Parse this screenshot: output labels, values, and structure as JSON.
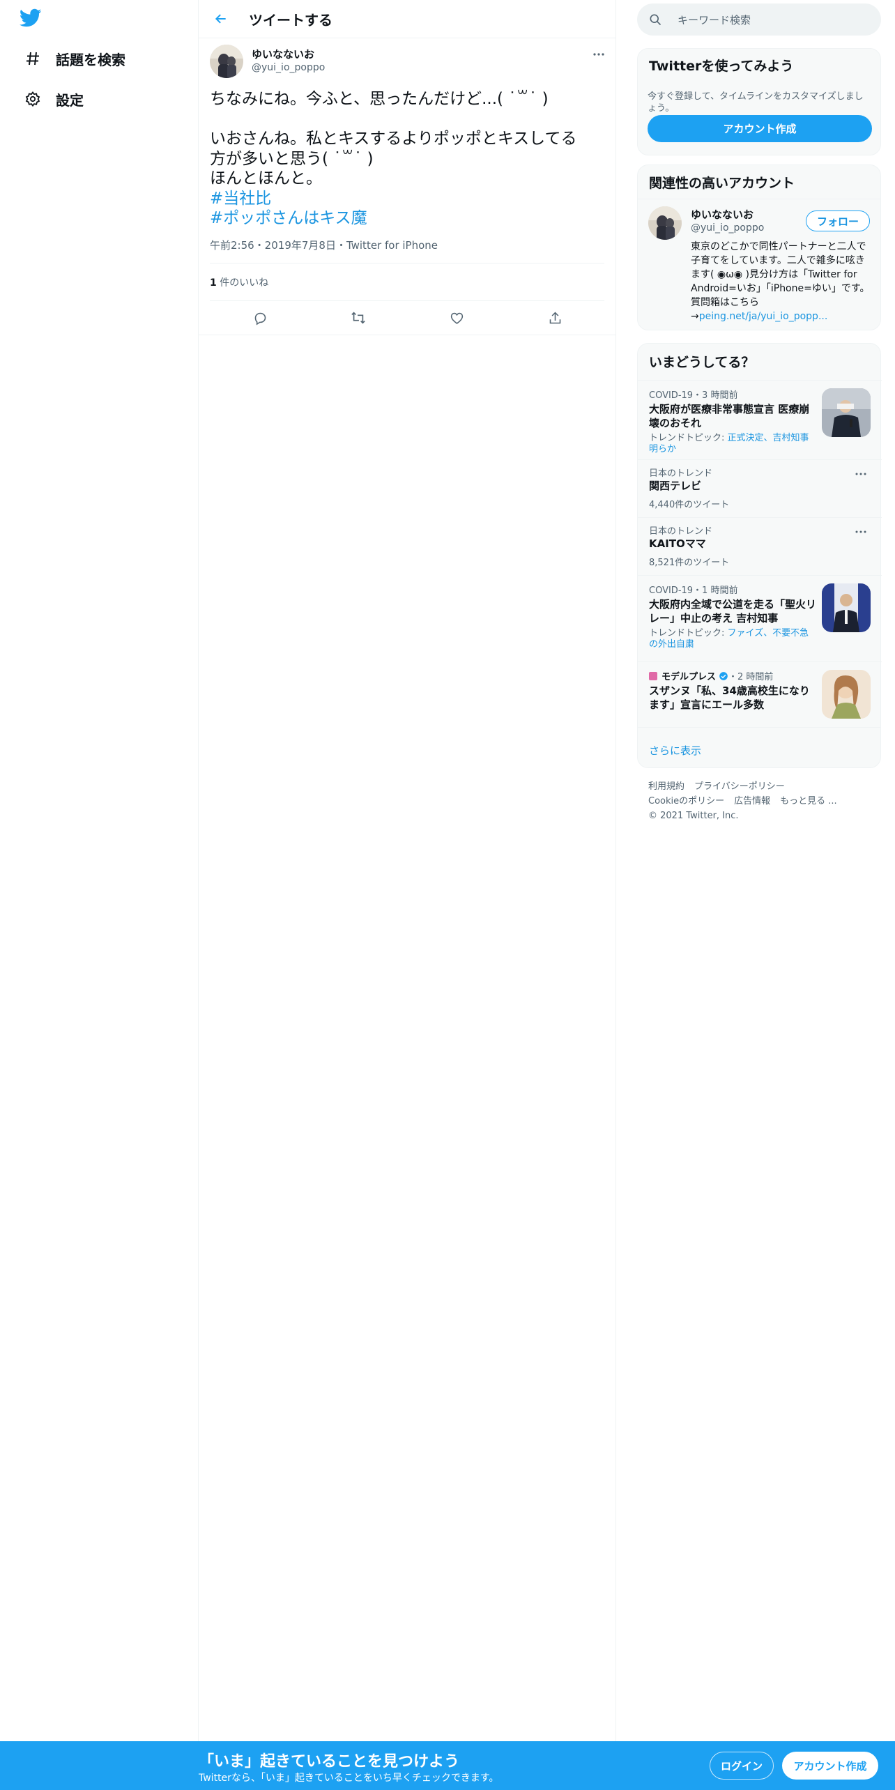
{
  "nav": {
    "items": [
      {
        "label": "話題を検索",
        "icon": "hashtag-icon"
      },
      {
        "label": "設定",
        "icon": "gear-icon"
      }
    ]
  },
  "header": {
    "title": "ツイートする"
  },
  "tweet": {
    "author_name": "ゆいなないお",
    "author_handle": "@yui_io_poppo",
    "lines": [
      "ちなみにね。今ふと、思ったんだけど...( ˙꒳˙ )",
      "",
      "いおさんね。私とキスするよりポッポとキスしてる",
      "方が多いと思う( ˙꒳˙ )",
      "ほんとほんと。"
    ],
    "hashtags": [
      "#当社比",
      "#ポッポさんはキス魔"
    ],
    "meta": "午前2:56・2019年7月8日・Twitter for iPhone",
    "like_count": "1",
    "like_label": " 件のいいね"
  },
  "search": {
    "placeholder": "キーワード検索"
  },
  "signup": {
    "title": "Twitterを使ってみよう",
    "subtitle": "今すぐ登録して、タイムラインをカスタマイズしましょう。",
    "button": "アカウント作成"
  },
  "related": {
    "title": "関連性の高いアカウント",
    "name": "ゆいなないお",
    "handle": "@yui_io_poppo",
    "follow": "フォロー",
    "bio": "東京のどこかで同性パートナーと二人で子育てをしています。二人で雑多に呟きます( ◉ω◉ )見分け方は「Twitter for Android=いお」「iPhone=ゆい」です。質問箱はこちら→",
    "bio_link": "peing.net/ja/yui_io_popp..."
  },
  "trends": {
    "title": "いまどうしてる？",
    "items": [
      {
        "meta": "COVID-19・3 時間前",
        "title": "大阪府が医療非常事態宣言 医療崩壊のおそれ",
        "sub_prefix": "トレンドトピック: ",
        "sub_link": "正式決定、吉村知事明らか"
      },
      {
        "meta": "日本のトレンド",
        "title": "関西テレビ",
        "count": "4,440件のツイート"
      },
      {
        "meta": "日本のトレンド",
        "title": "KAITOママ",
        "count": "8,521件のツイート"
      },
      {
        "meta": "COVID-19・1 時間前",
        "title": "大阪府内全域で公道を走る「聖火リレー」中止の考え 吉村知事",
        "sub_prefix": "トレンドトピック: ",
        "sub_link": "ファイズ、不要不急の外出自粛"
      },
      {
        "source": "モデルプレス",
        "time": "・2 時間前",
        "title": "スザンヌ「私、34歳高校生になります」宣言にエール多数"
      }
    ],
    "show_more": "さらに表示"
  },
  "footer": {
    "links": [
      "利用規約",
      "プライバシーポリシー",
      "Cookieのポリシー",
      "広告情報",
      "もっと見る ..."
    ],
    "copyright": "© 2021 Twitter, Inc."
  },
  "banner": {
    "title": "「いま」起きていることを見つけよう",
    "subtitle": "Twitterなら、「いま」起きていることをいち早くチェックできます。",
    "login": "ログイン",
    "signup": "アカウント作成"
  },
  "colors": {
    "accent": "#1da1f2",
    "link": "#1b95e0",
    "text": "#0f1419",
    "muted": "#536471"
  }
}
